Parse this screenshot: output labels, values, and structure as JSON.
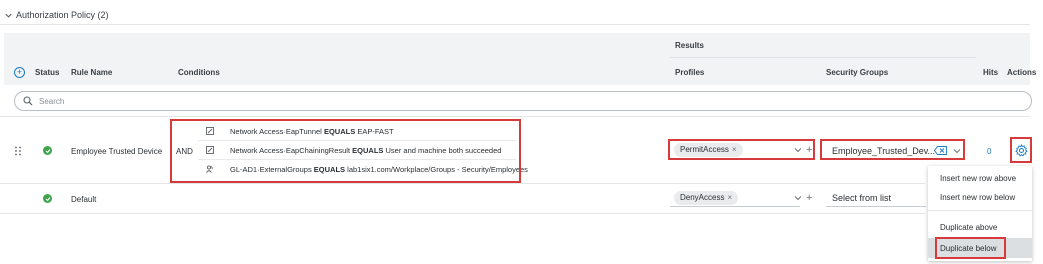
{
  "section": {
    "title": "Authorization Policy (2)",
    "expand_icon": "chevron-down-icon"
  },
  "table": {
    "group_header": "Results",
    "columns": {
      "status": "Status",
      "rule_name": "Rule Name",
      "conditions": "Conditions",
      "profiles": "Profiles",
      "security_groups": "Security Groups",
      "hits": "Hits",
      "actions": "Actions"
    },
    "add_icon": "plus-circle-icon"
  },
  "search": {
    "placeholder": "Search",
    "value": ""
  },
  "rows": [
    {
      "status": "enabled",
      "name": "Employee Trusted Device",
      "operator": "AND",
      "conditions": [
        {
          "icon": "condition-doc-icon",
          "attr": "Network Access·EapTunnel",
          "op": "EQUALS",
          "value": "EAP-FAST"
        },
        {
          "icon": "condition-doc-icon",
          "attr": "Network Access·EapChainingResult",
          "op": "EQUALS",
          "value": "User and machine both succeeded"
        },
        {
          "icon": "user-group-icon",
          "attr": "GL-AD1·ExternalGroups",
          "op": "EQUALS",
          "value": "lab1six1.com/Workplace/Groups - Security/Employees"
        }
      ],
      "profile": "PermitAccess",
      "security_group": "Employee_Trusted_Dev...",
      "hits": "0"
    },
    {
      "status": "enabled",
      "name": "Default",
      "profile": "DenyAccess",
      "security_group_placeholder": "Select from list"
    }
  ],
  "action_menu": {
    "items": [
      "Insert new row above",
      "Insert new row below",
      "Duplicate above",
      "Duplicate below"
    ],
    "selected": "Duplicate below"
  },
  "colors": {
    "accent": "#1a7cc5",
    "status_ok": "#3da34d",
    "highlight": "#d63a3a",
    "header_bg": "#f1f3f4"
  }
}
